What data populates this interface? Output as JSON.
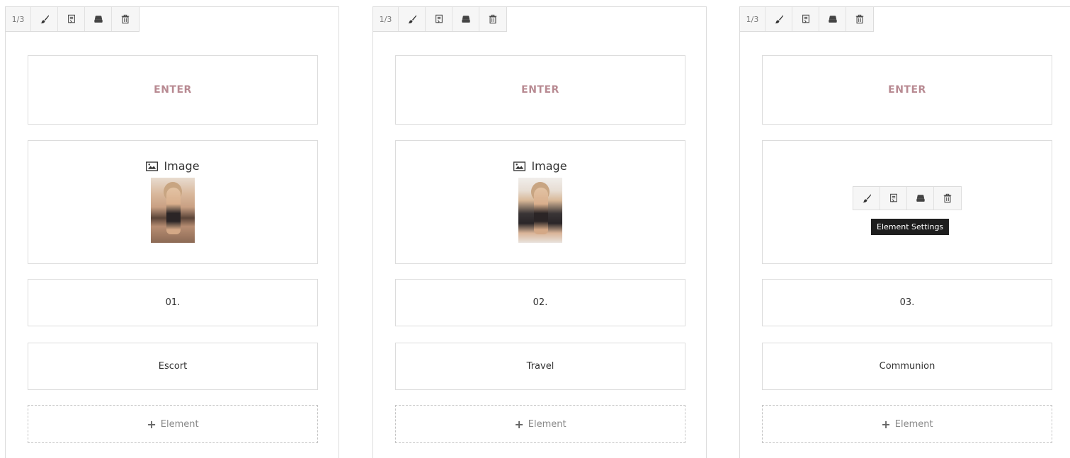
{
  "columns": [
    {
      "ratio": "1/3",
      "enter_label": "ENTER",
      "image_label": "Image",
      "number": "01.",
      "text": "Escort",
      "add_label": "Element"
    },
    {
      "ratio": "1/3",
      "enter_label": "ENTER",
      "image_label": "Image",
      "number": "02.",
      "text": "Travel",
      "add_label": "Element"
    },
    {
      "ratio": "1/3",
      "enter_label": "ENTER",
      "number": "03.",
      "text": "Communion",
      "add_label": "Element",
      "tooltip": "Element Settings"
    }
  ],
  "toolbar_icons": [
    "brush-icon",
    "clone-icon",
    "save-icon",
    "trash-icon"
  ],
  "colors": {
    "accent": "#b88a92",
    "border": "#dcdcdc",
    "toolbar_bg": "#f6f6f6",
    "tooltip_bg": "#1e1e1e"
  }
}
